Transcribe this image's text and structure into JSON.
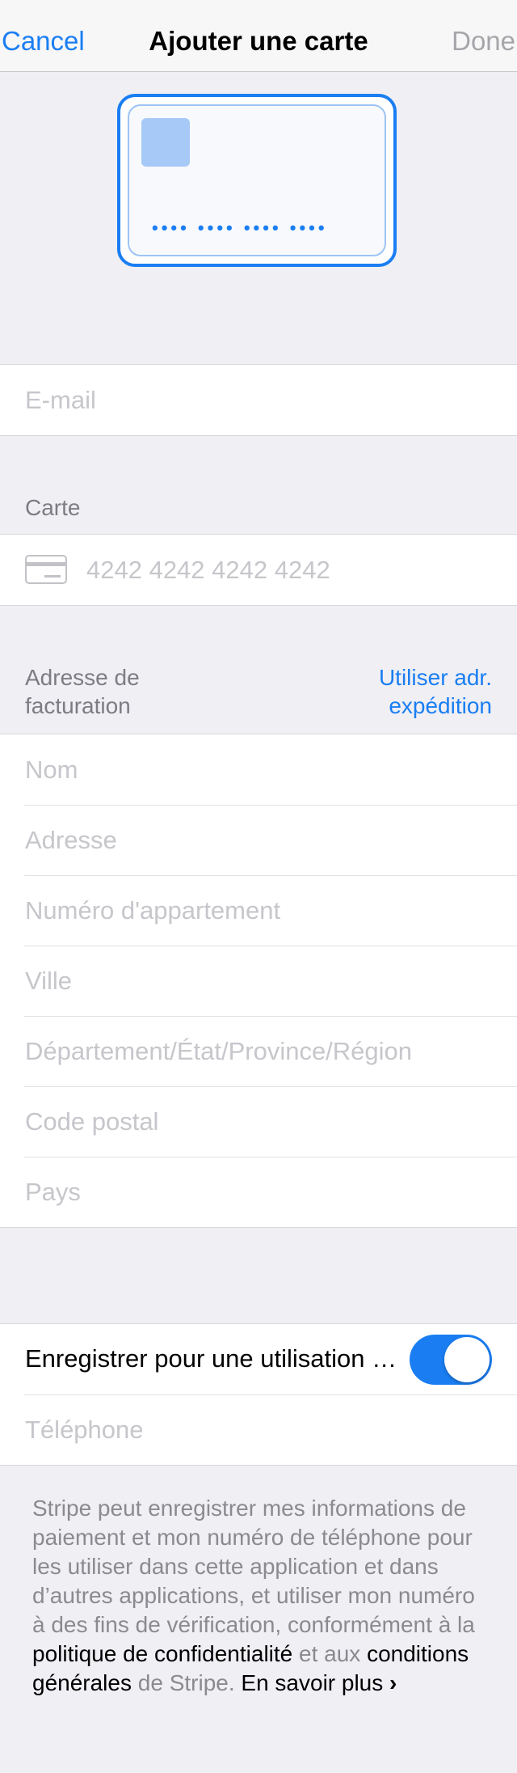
{
  "nav": {
    "cancel": "Cancel",
    "title": "Ajouter une carte",
    "done": "Done"
  },
  "card_illustration": {
    "number_mask": "•••• •••• •••• ••••"
  },
  "email": {
    "placeholder": "E-mail"
  },
  "card_section": {
    "header": "Carte",
    "number_placeholder": "4242 4242 4242 4242"
  },
  "billing": {
    "header_line1": "Adresse de",
    "header_line2": "facturation",
    "action_line1": "Utiliser adr.",
    "action_line2": "expédition",
    "fields": {
      "name": "Nom",
      "address": "Adresse",
      "apartment": "Numéro d'appartement",
      "city": "Ville",
      "region": "Département/État/Province/Région",
      "postal": "Code postal",
      "country": "Pays"
    }
  },
  "save": {
    "label": "Enregistrer pour une utilisation ultérieure",
    "toggle_on": true,
    "phone_placeholder": "Téléphone"
  },
  "footer": {
    "text1": "Stripe peut enregistrer mes informations de paiement et mon numéro de téléphone pour les utiliser dans cette application et dans d’autres applications, et utiliser mon numéro à des fins de vérification, conformément à la ",
    "link_privacy": "politique de confidentialité",
    "text2": " et aux ",
    "link_terms": "conditions générales",
    "text3": " de Stripe. ",
    "learn_more": "En savoir plus",
    "chevron": "›"
  },
  "colors": {
    "accent": "#1a7ef2",
    "background": "#efeff4"
  }
}
